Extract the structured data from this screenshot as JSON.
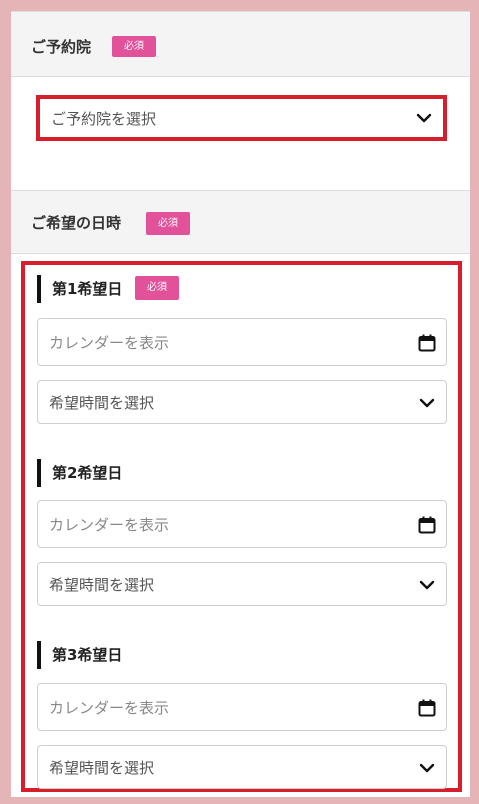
{
  "clinic": {
    "title": "ご予約院",
    "badge": "必須",
    "select_value": "ご予約院を選択"
  },
  "datetime": {
    "title": "ご希望の日時",
    "badge": "必須",
    "days": [
      {
        "label": "第1希望日",
        "badge": "必須",
        "date_placeholder": "カレンダーを表示",
        "time_value": "希望時間を選択"
      },
      {
        "label": "第2希望日",
        "date_placeholder": "カレンダーを表示",
        "time_value": "希望時間を選択"
      },
      {
        "label": "第3希望日",
        "date_placeholder": "カレンダーを表示",
        "time_value": "希望時間を選択"
      }
    ]
  },
  "icons": {
    "select_arrow": "chevron-down-icon",
    "calendar": "calendar-icon"
  },
  "colors": {
    "badge": "#e2529b",
    "highlight_frame": "#d61f2a",
    "outer_background": "#e4b4b6",
    "section_header": "#f4f4f4"
  }
}
